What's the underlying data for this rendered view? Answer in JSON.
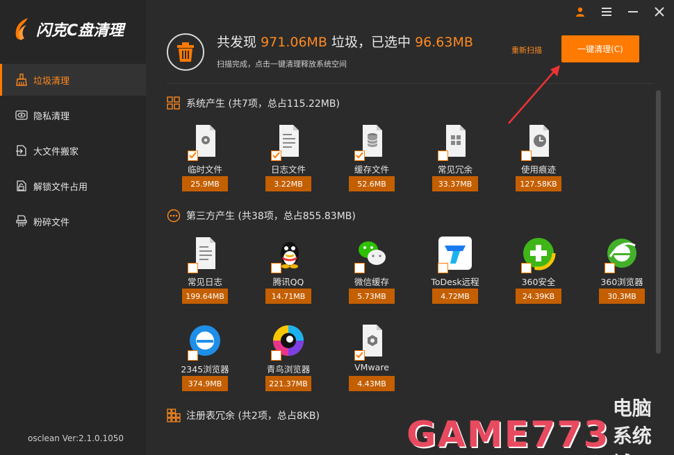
{
  "app": {
    "logo_text": "闪克C盘清理",
    "version": "osclean Ver:2.1.0.1050",
    "accent": "#ff7a00"
  },
  "sidebar": {
    "items": [
      {
        "label": "垃圾清理",
        "icon": "broom-icon",
        "active": true
      },
      {
        "label": "隐私清理",
        "icon": "eye-icon",
        "active": false
      },
      {
        "label": "大文件搬家",
        "icon": "move-file-icon",
        "active": false
      },
      {
        "label": "解锁文件占用",
        "icon": "unlock-file-icon",
        "active": false
      },
      {
        "label": "粉碎文件",
        "icon": "shredder-icon",
        "active": false
      }
    ]
  },
  "header": {
    "summary_prefix": "共发现",
    "found_total": "971.06MB",
    "summary_mid": "垃圾，已选中",
    "selected_total": "96.63MB",
    "subtitle": "扫描完成，点击一键清理释放系统空间",
    "rescan_label": "重新扫描",
    "clean_label": "一键清理(C)"
  },
  "sections": [
    {
      "title": "系统产生 (共7项，总占115.22MB)",
      "icon": "grid-icon",
      "items": [
        {
          "label": "临时文件",
          "size": "25.9MB",
          "icon": "gear-file-icon"
        },
        {
          "label": "日志文件",
          "size": "3.22MB",
          "icon": "log-file-icon"
        },
        {
          "label": "缓存文件",
          "size": "52.6MB",
          "icon": "database-file-icon"
        },
        {
          "label": "常见冗余",
          "size": "33.37MB",
          "icon": "windows-file-icon"
        },
        {
          "label": "使用痕迹",
          "size": "127.58KB",
          "icon": "clock-file-icon"
        }
      ]
    },
    {
      "title": "第三方产生 (共38项，总占855.83MB)",
      "icon": "more-icon",
      "items": [
        {
          "label": "常见日志",
          "size": "199.64MB",
          "icon": "log-file-icon"
        },
        {
          "label": "腾讯QQ",
          "size": "14.71MB",
          "icon": "qq-icon"
        },
        {
          "label": "微信缓存",
          "size": "5.73MB",
          "icon": "wechat-icon"
        },
        {
          "label": "ToDesk远程",
          "size": "4.72MB",
          "icon": "todesk-icon"
        },
        {
          "label": "360安全",
          "size": "24.39KB",
          "icon": "360-safe-icon"
        },
        {
          "label": "360浏览器",
          "size": "30.3MB",
          "icon": "360-browser-icon"
        },
        {
          "label": "2345浏览器",
          "size": "374.9MB",
          "icon": "2345-browser-icon"
        },
        {
          "label": "青鸟浏览器",
          "size": "221.37MB",
          "icon": "qingniao-browser-icon"
        },
        {
          "label": "VMware",
          "size": "4.43MB",
          "icon": "vmware-file-icon"
        }
      ]
    },
    {
      "title": "注册表冗余 (共2项，总占8KB)",
      "icon": "registry-icon",
      "items": []
    }
  ],
  "watermark": {
    "brand": "GAME773",
    "site": "电脑系统城"
  }
}
